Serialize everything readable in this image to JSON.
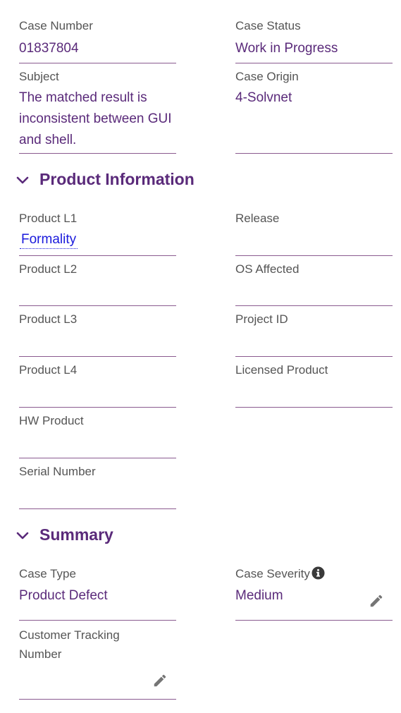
{
  "colors": {
    "accent": "#5a2a7a",
    "link": "#1a1adc",
    "underline": "#8a5a8f",
    "label": "#555555"
  },
  "case": {
    "number_label": "Case Number",
    "number": "01837804",
    "status_label": "Case Status",
    "status": "Work in Progress",
    "subject_label": "Subject",
    "subject": "The matched result is inconsistent between GUI and shell.",
    "origin_label": "Case Origin",
    "origin": "4-Solvnet"
  },
  "product": {
    "section_title": "Product Information",
    "l1_label": "Product L1",
    "l1": "Formality",
    "release_label": "Release",
    "l2_label": "Product L2",
    "os_label": "OS Affected",
    "l3_label": "Product L3",
    "project_label": "Project ID",
    "l4_label": "Product L4",
    "licensed_label": "Licensed Product",
    "hw_label": "HW Product",
    "serial_label": "Serial Number"
  },
  "summary": {
    "section_title": "Summary",
    "type_label": "Case Type",
    "type": "Product Defect",
    "severity_label": "Case Severity",
    "severity": "Medium",
    "tracking_label": "Customer Tracking Number"
  },
  "icons": {
    "section_toggle": "chevron-down-icon",
    "info": "info-icon",
    "edit": "pencil-icon"
  }
}
